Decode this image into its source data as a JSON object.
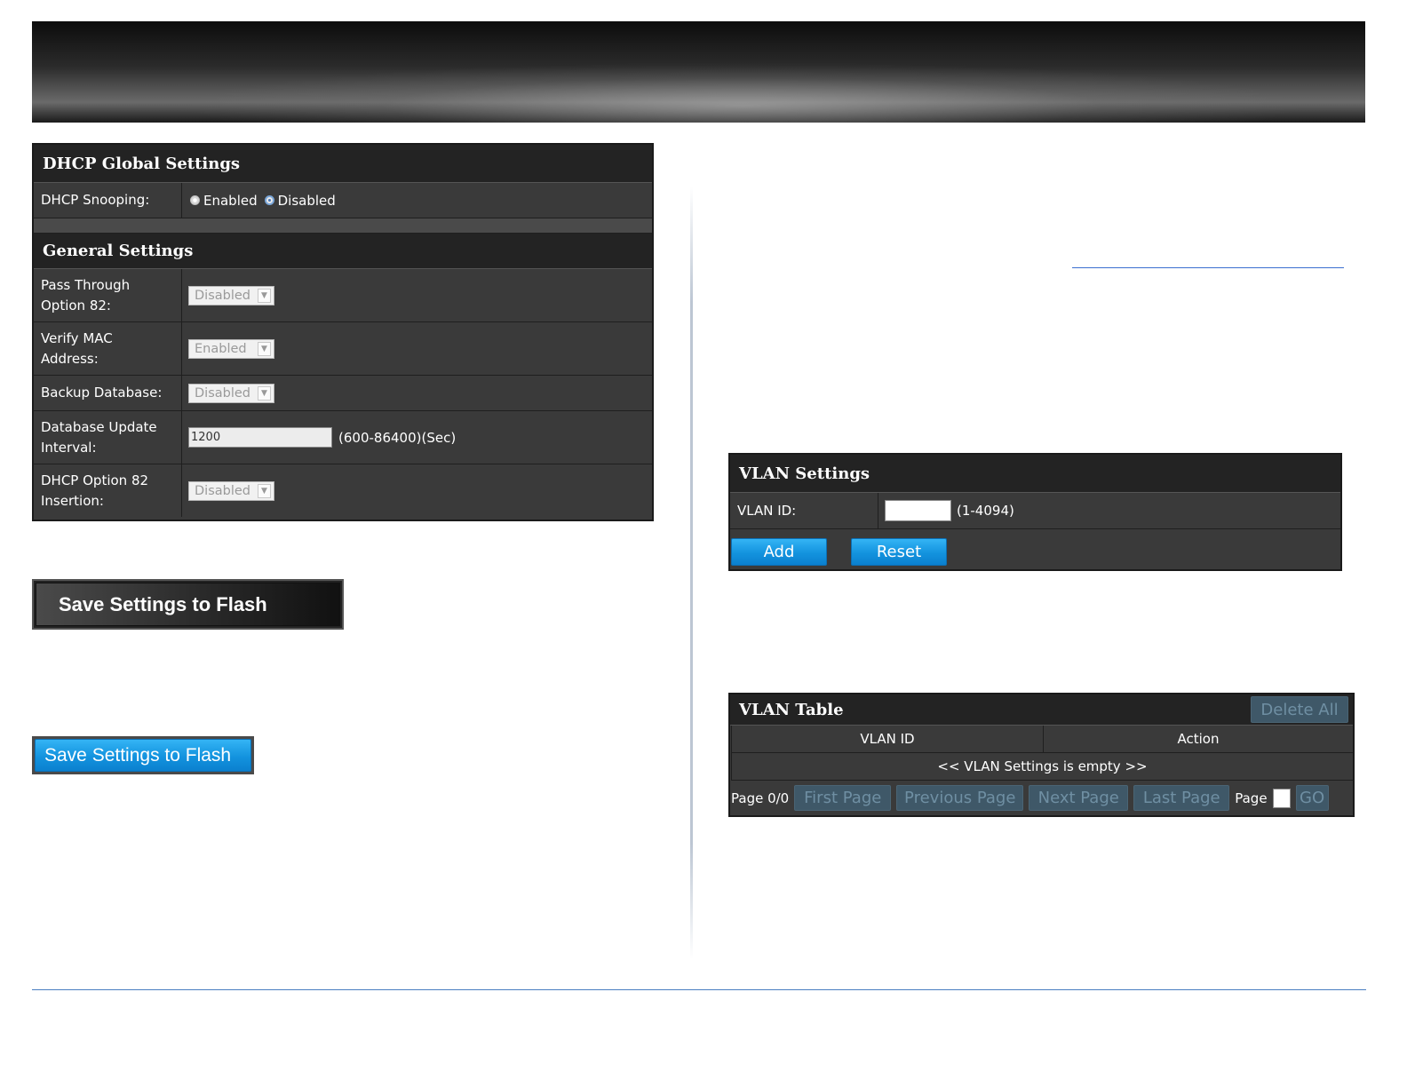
{
  "dhcp_global": {
    "title": "DHCP Global Settings",
    "snooping_label": "DHCP Snooping:",
    "option_enabled": "Enabled",
    "option_disabled": "Disabled"
  },
  "general": {
    "title": "General Settings",
    "pass_through_label_1": "Pass Through",
    "pass_through_label_2": "Option 82:",
    "pass_through_value": "Disabled",
    "verify_mac_label_1": "Verify MAC",
    "verify_mac_label_2": "Address:",
    "verify_mac_value": "Enabled",
    "backup_label": "Backup Database:",
    "backup_value": "Disabled",
    "interval_label_1": "Database Update",
    "interval_label_2": "Interval:",
    "interval_value": "1200",
    "interval_hint": "(600-86400)(Sec)",
    "option82_label_1": "DHCP Option 82",
    "option82_label_2": "Insertion:",
    "option82_value": "Disabled"
  },
  "save_flash_dark": "Save Settings to Flash",
  "save_flash_blue": "Save Settings to Flash",
  "vlan_settings": {
    "title": "VLAN Settings",
    "vlan_id_label": "VLAN ID:",
    "vlan_id_value": "",
    "vlan_id_hint": "(1-4094)",
    "add_label": "Add",
    "reset_label": "Reset"
  },
  "vlan_table": {
    "title": "VLAN Table",
    "delete_all": "Delete All",
    "columns": [
      "VLAN ID",
      "Action"
    ],
    "empty_message": "<< VLAN Settings is empty >>",
    "page_info": "Page 0/0",
    "first_page": "First Page",
    "previous_page": "Previous Page",
    "next_page": "Next Page",
    "last_page": "Last Page",
    "page_label": "Page",
    "page_input_value": "",
    "go_label": "GO"
  },
  "colors": {
    "panel_bg": "#3a3a3a",
    "panel_header": "#232323",
    "accent_blue": "#1393de",
    "rule_blue": "#4a7fc2"
  }
}
